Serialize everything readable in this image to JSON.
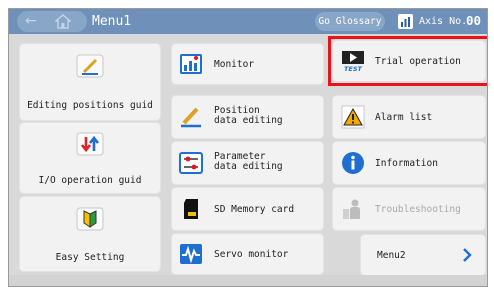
{
  "header": {
    "title": "Menu1",
    "glossary_label": "Go Glossary",
    "axis_label": "Axis No.",
    "axis_value": "00"
  },
  "left_buttons": [
    {
      "label": "Editing positions guid",
      "icon": "pencil-icon"
    },
    {
      "label": "I/O operation guid",
      "icon": "io-arrows-icon"
    },
    {
      "label": "Easy Setting",
      "icon": "beginner-mark-icon"
    }
  ],
  "middle_buttons": [
    {
      "label": "Monitor",
      "icon": "monitor-chart-icon"
    },
    {
      "line1": "Position",
      "line2": "data editing",
      "icon": "pencil-icon"
    },
    {
      "line1": "Parameter",
      "line2": "data editing",
      "icon": "parameter-sliders-icon"
    },
    {
      "label": "SD Memory card",
      "icon": "sd-card-icon"
    },
    {
      "label": "Servo monitor",
      "icon": "waveform-icon"
    }
  ],
  "right_buttons": [
    {
      "label": "Trial operation",
      "icon": "test-play-icon",
      "icon_text": "TEST",
      "highlighted": true
    },
    {
      "label": "Alarm list",
      "icon": "warning-icon"
    },
    {
      "label": "Information",
      "icon": "info-icon"
    },
    {
      "label": "Troubleshooting",
      "icon": "troubleshooting-icon",
      "disabled": true
    },
    {
      "label": "Menu2",
      "icon": "chevron-right-icon"
    }
  ],
  "colors": {
    "header_bg": "#6f90b8",
    "panel_bg": "#d9d9d9",
    "button_bg": "#f2f2f2",
    "highlight": "#e8141b",
    "accent_blue": "#1f6fd1"
  }
}
